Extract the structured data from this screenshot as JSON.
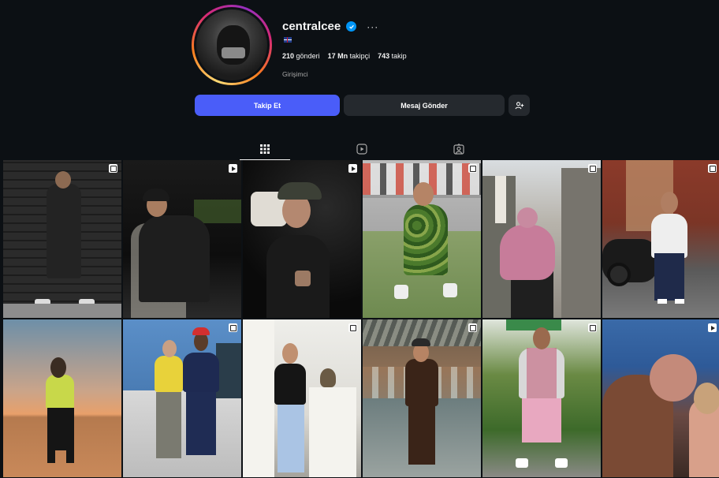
{
  "profile": {
    "username": "centralcee",
    "verified": true,
    "more_icon": "ellipsis-icon",
    "flag": "uk-flag",
    "stats": {
      "posts_value": "210",
      "posts_label": "gönderi",
      "followers_value": "17 Mn",
      "followers_label": "takipçi",
      "following_value": "743",
      "following_label": "takip"
    },
    "bio": "Girişimci"
  },
  "actions": {
    "follow_label": "Takip Et",
    "message_label": "Mesaj Gönder",
    "suggest_icon": "add-person-icon"
  },
  "colors": {
    "background": "#0c1014",
    "follow_button": "#4a5df9",
    "secondary_button": "#25292e",
    "verified_badge": "#0095f6"
  },
  "tabs": [
    {
      "icon": "grid-icon",
      "active": true
    },
    {
      "icon": "reels-icon",
      "active": false
    },
    {
      "icon": "tagged-icon",
      "active": false
    }
  ],
  "posts": [
    {
      "type": "carousel",
      "scene": "brick-wall-tracksuit"
    },
    {
      "type": "reel",
      "scene": "car-night"
    },
    {
      "type": "reel",
      "scene": "car-cap"
    },
    {
      "type": "carousel",
      "scene": "camo-sneaker-store"
    },
    {
      "type": "carousel",
      "scene": "street-pink-hoodie"
    },
    {
      "type": "carousel",
      "scene": "motorbike-street"
    },
    {
      "type": "none",
      "scene": "desert-sunset"
    },
    {
      "type": "carousel",
      "scene": "two-men-store"
    },
    {
      "type": "carousel",
      "scene": "cat-white-stairs"
    },
    {
      "type": "carousel",
      "scene": "suit-pool-hall"
    },
    {
      "type": "carousel",
      "scene": "pink-shorts-garden"
    },
    {
      "type": "reel",
      "scene": "dance-closeup"
    }
  ]
}
